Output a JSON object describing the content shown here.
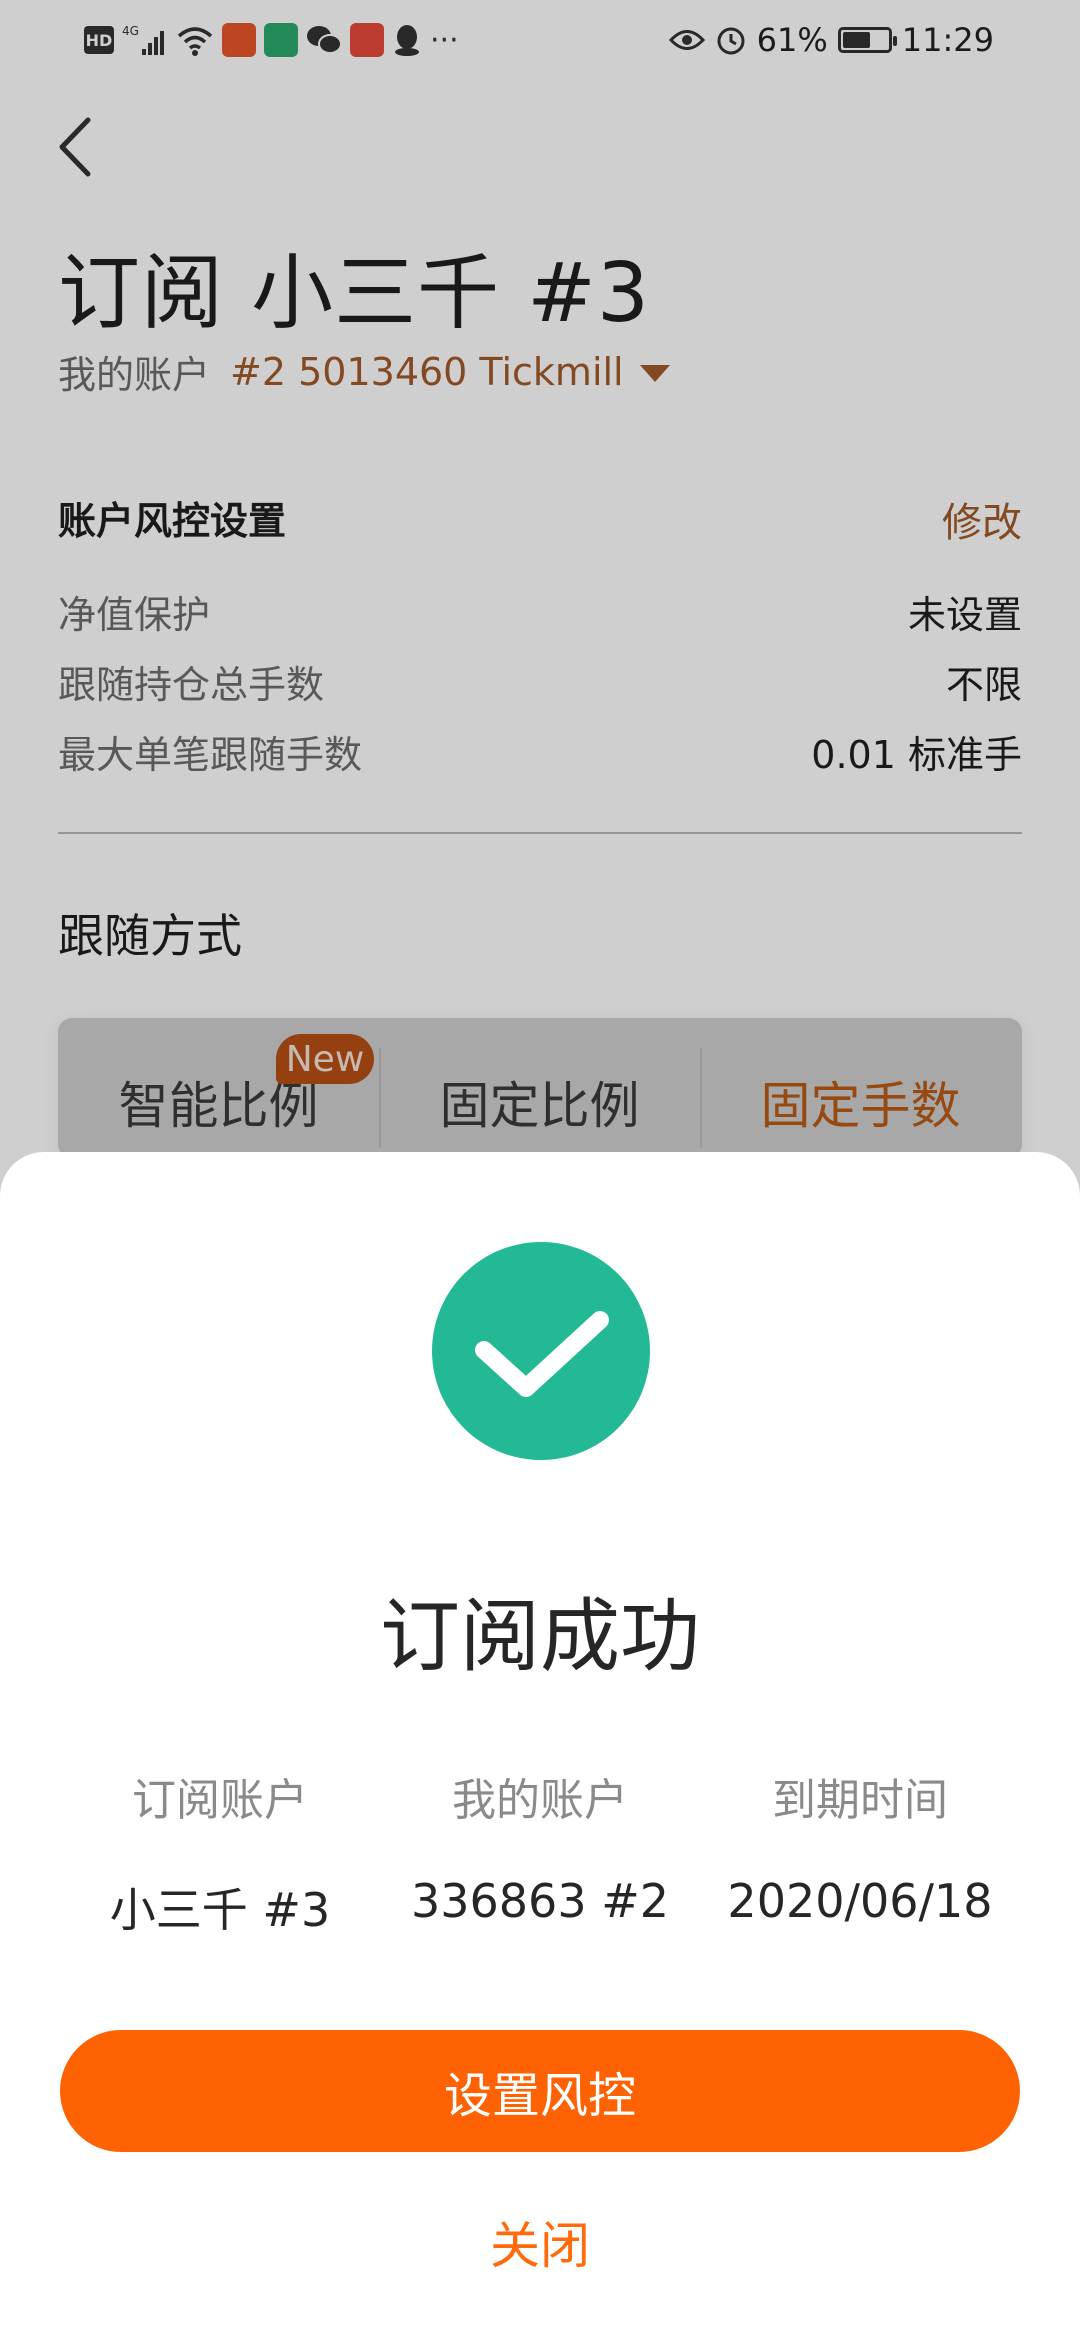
{
  "status_bar": {
    "network": "4G",
    "battery_percent": "61%",
    "battery_level": 0.61,
    "time": "11:29",
    "more": "···",
    "icons": [
      "hd-icon",
      "signal-icon",
      "wifi-icon",
      "app-icon",
      "app-icon",
      "wechat-icon",
      "app-icon",
      "qq-icon",
      "eye-icon",
      "alarm-icon",
      "battery-icon"
    ]
  },
  "header": {
    "title": "订阅 小三千 #3",
    "account_label": "我的账户",
    "account_value": "#2 5013460 Tickmill"
  },
  "risk": {
    "title": "账户风控设置",
    "edit": "修改",
    "rows": [
      {
        "label": "净值保护",
        "value": "未设置"
      },
      {
        "label": "跟随持仓总手数",
        "value": "不限"
      },
      {
        "label": "最大单笔跟随手数",
        "value": "0.01 标准手"
      }
    ]
  },
  "follow": {
    "title": "跟随方式",
    "tabs": [
      {
        "label": "智能比例",
        "badge": "New"
      },
      {
        "label": "固定比例"
      },
      {
        "label": "固定手数"
      }
    ],
    "active_tab": 2
  },
  "dialog": {
    "title": "订阅成功",
    "columns": [
      {
        "header": "订阅账户",
        "value": "小三千 #3"
      },
      {
        "header": "我的账户",
        "value": "336863 #2"
      },
      {
        "header": "到期时间",
        "value": "2020/06/18"
      }
    ],
    "primary_button": "设置风控",
    "close": "关闭"
  },
  "colors": {
    "accent_brown": "#a25a2c",
    "primary_orange": "#ff6203",
    "success_green": "#22b994"
  }
}
